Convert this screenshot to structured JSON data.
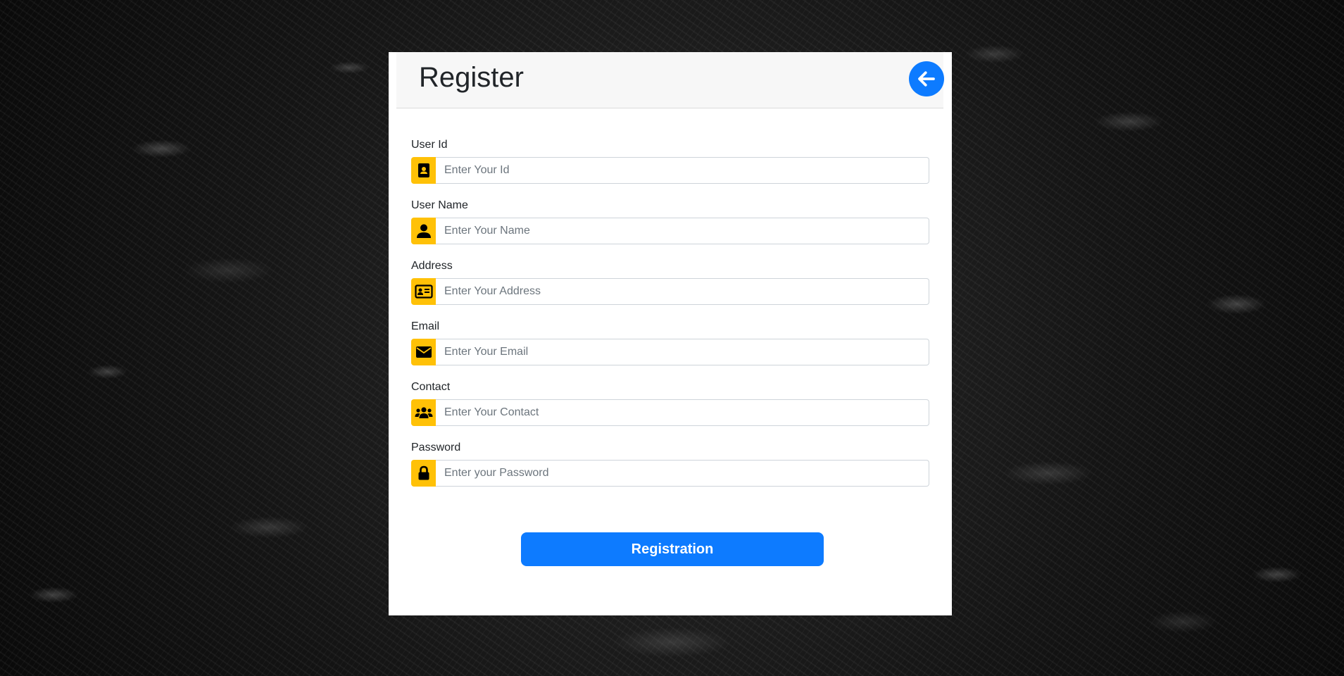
{
  "page": {
    "title": "Register",
    "back_button_label": "Back"
  },
  "form": {
    "fields": [
      {
        "label": "User Id",
        "placeholder": "Enter Your Id",
        "icon": "contact-book-icon"
      },
      {
        "label": "User Name",
        "placeholder": "Enter Your Name",
        "icon": "user-icon"
      },
      {
        "label": "Address",
        "placeholder": "Enter Your Address",
        "icon": "address-card-icon"
      },
      {
        "label": "Email",
        "placeholder": "Enter Your Email",
        "icon": "envelope-icon"
      },
      {
        "label": "Contact",
        "placeholder": "Enter Your Contact",
        "icon": "users-icon"
      },
      {
        "label": "Password",
        "placeholder": "Enter your Password",
        "icon": "lock-icon"
      }
    ],
    "submit_label": "Registration"
  },
  "colors": {
    "accent": "#0d7bff",
    "icon_background": "#ffc107",
    "header_background": "#f7f7f7",
    "card_background": "#ffffff"
  }
}
